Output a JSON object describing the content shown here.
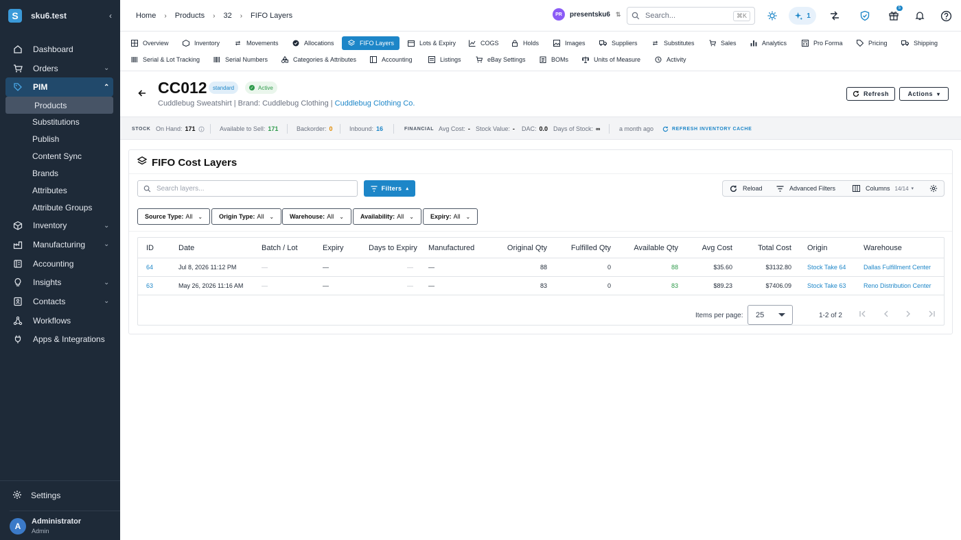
{
  "app": {
    "workspace": "sku6.test",
    "logo_letter": "S"
  },
  "sidebar": {
    "items": [
      {
        "label": "Dashboard",
        "icon": "home-icon"
      },
      {
        "label": "Orders",
        "icon": "cart-icon"
      },
      {
        "label": "PIM",
        "icon": "tag-icon"
      },
      {
        "label": "Inventory",
        "icon": "box-icon"
      },
      {
        "label": "Manufacturing",
        "icon": "factory-icon"
      },
      {
        "label": "Accounting",
        "icon": "ledger-icon"
      },
      {
        "label": "Insights",
        "icon": "lightbulb-icon"
      },
      {
        "label": "Contacts",
        "icon": "contacts-icon"
      },
      {
        "label": "Workflows",
        "icon": "workflow-icon"
      },
      {
        "label": "Apps & Integrations",
        "icon": "plug-icon"
      }
    ],
    "pim_children": [
      "Products",
      "Substitutions",
      "Publish",
      "Content Sync",
      "Brands",
      "Attributes",
      "Attribute Groups"
    ],
    "settings_label": "Settings",
    "user": {
      "initial": "A",
      "name": "Administrator",
      "role": "Admin"
    }
  },
  "topbar": {
    "breadcrumbs": [
      "Home",
      "Products",
      "32",
      "FIFO Layers"
    ],
    "store": {
      "initials": "PR",
      "name": "presentsku6"
    },
    "search_placeholder": "Search...",
    "search_shortcut": "⌘K",
    "ai_count": "1",
    "gift_badge": "5"
  },
  "tabs_row1": [
    "Overview",
    "Inventory",
    "Movements",
    "Allocations",
    "FIFO Layers",
    "Lots & Expiry",
    "COGS",
    "Holds",
    "Images",
    "Suppliers",
    "Substitutes",
    "Sales",
    "Analytics",
    "Pro Forma",
    "Pricing",
    "Shipping"
  ],
  "tabs_row2": [
    "Serial & Lot Tracking",
    "Serial Numbers",
    "Categories & Attributes",
    "Accounting",
    "Listings",
    "eBay Settings",
    "BOMs",
    "Units of Measure",
    "Activity"
  ],
  "active_tab": "FIFO Layers",
  "product": {
    "sku": "CC012",
    "type_badge": "standard",
    "status_badge": "Active",
    "name": "Cuddlebug Sweatshirt",
    "brand_prefix": "| Brand: Cuddlebug Clothing |",
    "brand_link": "Cuddlebug Clothing Co.",
    "refresh_label": "Refresh",
    "actions_label": "Actions"
  },
  "stock": {
    "stock_caption": "STOCK",
    "on_hand_label": "On Hand:",
    "on_hand": "171",
    "available_label": "Available to Sell:",
    "available": "171",
    "backorder_label": "Backorder:",
    "backorder": "0",
    "inbound_label": "Inbound:",
    "inbound": "16",
    "financial_caption": "FINANCIAL",
    "avg_cost_label": "Avg Cost:",
    "avg_cost": "-",
    "stock_value_label": "Stock Value:",
    "stock_value": "-",
    "dac_label": "DAC:",
    "dac": "0.0",
    "days_label": "Days of Stock:",
    "days": "∞",
    "updated": "a month ago",
    "refresh_cache": "REFRESH INVENTORY CACHE"
  },
  "card": {
    "title": "FIFO Cost Layers",
    "search_placeholder": "Search layers...",
    "filters_label": "Filters",
    "reload_label": "Reload",
    "advanced_label": "Advanced Filters",
    "columns_label": "Columns",
    "columns_count": "14/14",
    "chips": [
      {
        "key": "Source Type:",
        "value": "All"
      },
      {
        "key": "Origin Type:",
        "value": "All"
      },
      {
        "key": "Warehouse:",
        "value": "All"
      },
      {
        "key": "Availability:",
        "value": "All"
      },
      {
        "key": "Expiry:",
        "value": "All"
      }
    ]
  },
  "table": {
    "headers": [
      "ID",
      "Date",
      "Batch / Lot",
      "Expiry",
      "Days to Expiry",
      "Manufactured",
      "Original Qty",
      "Fulfilled Qty",
      "Available Qty",
      "Avg Cost",
      "Total Cost",
      "Origin",
      "Warehouse"
    ],
    "rows": [
      {
        "id": "64",
        "date": "Jul 8, 2026 11:12 PM",
        "batch": "—",
        "expiry": "—",
        "days": "—",
        "manufactured": "—",
        "original": "88",
        "fulfilled": "0",
        "available": "88",
        "avg": "$35.60",
        "total": "$3132.80",
        "origin": "Stock Take 64",
        "warehouse": "Dallas Fulfillment Center"
      },
      {
        "id": "63",
        "date": "May 26, 2026 11:16 AM",
        "batch": "—",
        "expiry": "—",
        "days": "—",
        "manufactured": "—",
        "original": "83",
        "fulfilled": "0",
        "available": "83",
        "avg": "$89.23",
        "total": "$7406.09",
        "origin": "Stock Take 63",
        "warehouse": "Reno Distribution Center"
      }
    ],
    "items_per_page_label": "Items per page:",
    "items_per_page": "25",
    "range": "1-2 of 2"
  },
  "colors": {
    "sidebar_bg": "#1e2a38",
    "accent": "#1d86c8",
    "success": "#2e9a4a",
    "warning": "#e08a00"
  }
}
